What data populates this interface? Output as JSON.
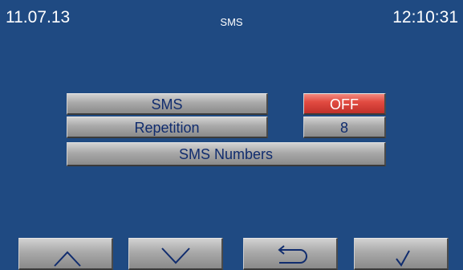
{
  "header": {
    "date": "11.07.13",
    "title": "SMS",
    "time": "12:10:31"
  },
  "menu": {
    "sms_label": "SMS",
    "sms_value": "OFF",
    "repetition_label": "Repetition",
    "repetition_value": "8",
    "sms_numbers_label": "SMS Numbers"
  },
  "nav": {
    "up_icon": "chevron-up-icon",
    "down_icon": "chevron-down-icon",
    "back_icon": "return-arrow-icon",
    "ok_icon": "checkmark-icon"
  },
  "colors": {
    "background": "#1f4a82",
    "button_gray": "#a9a9a9",
    "button_text": "#102c6e",
    "off_red": "#e24c42"
  }
}
